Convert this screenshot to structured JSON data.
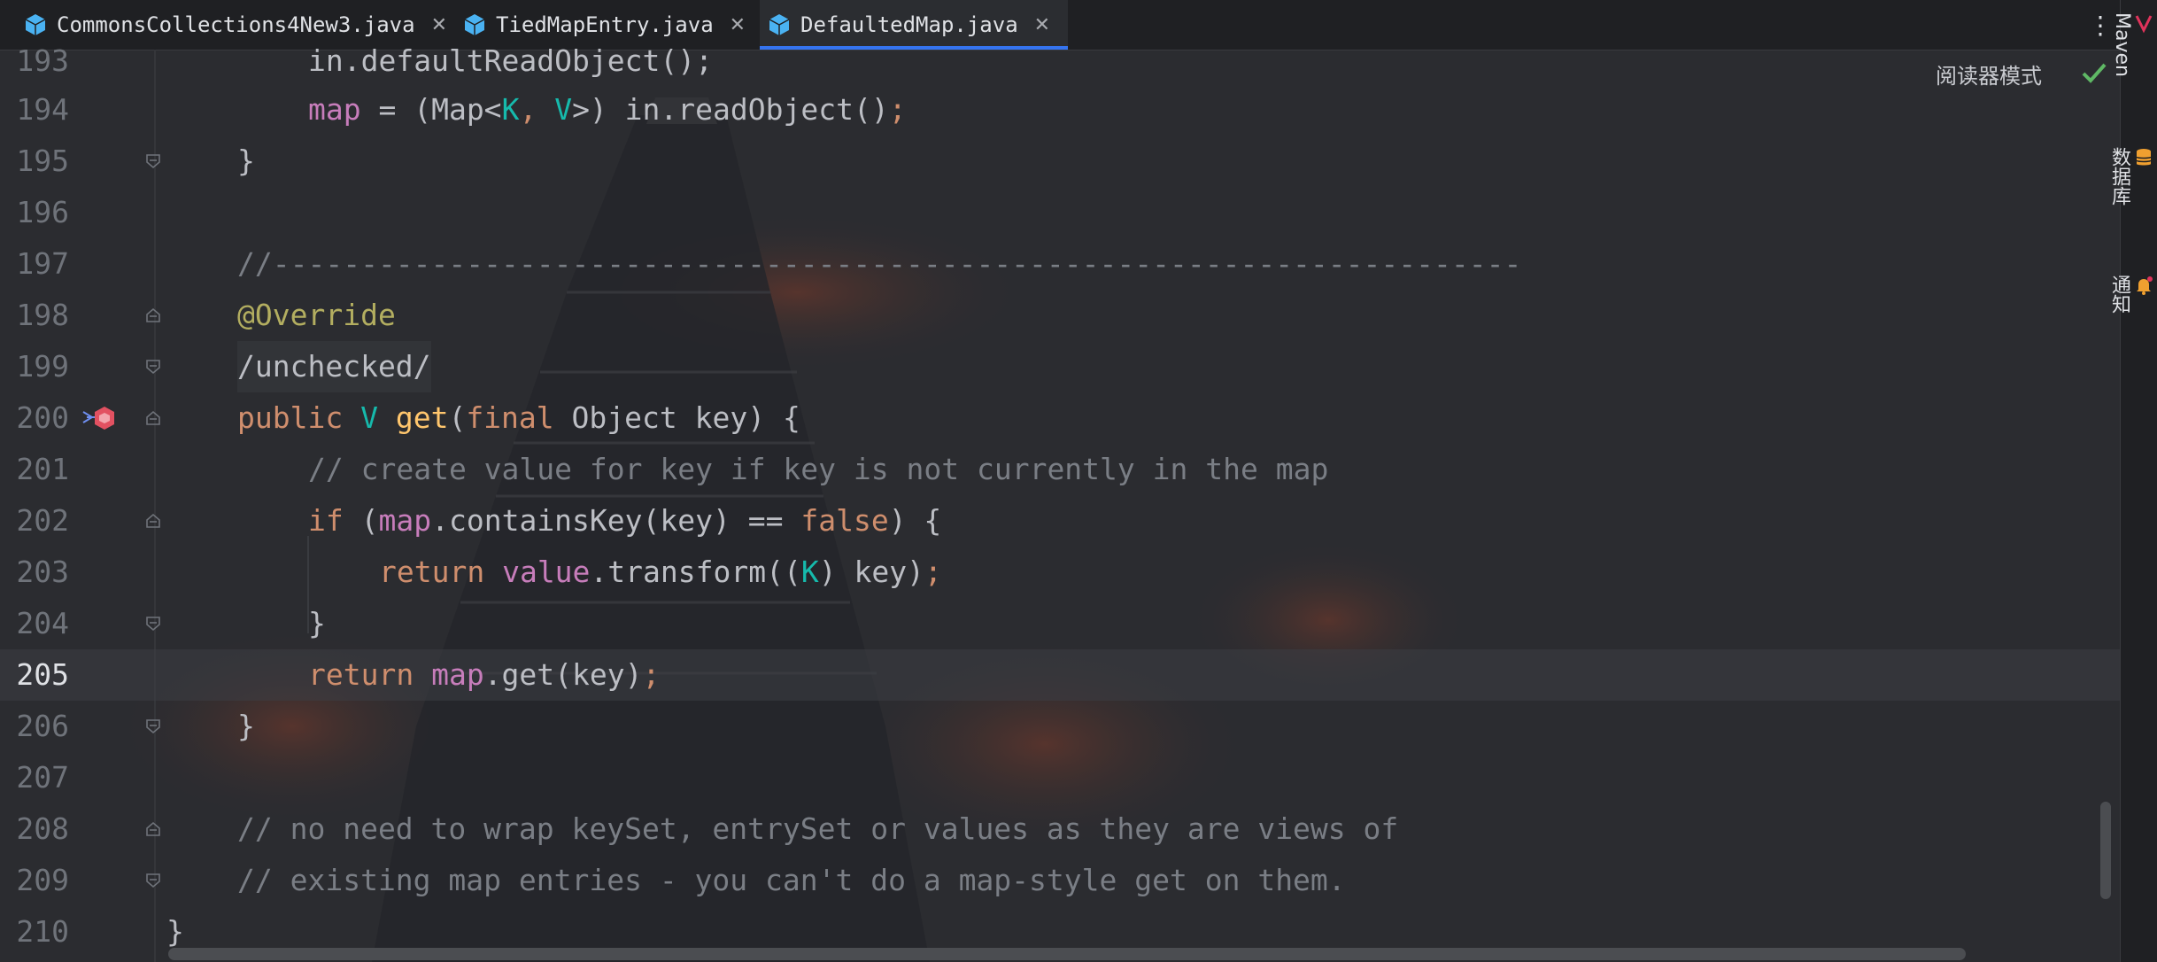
{
  "tabs": [
    {
      "label": "CommonsCollections4New3.java",
      "active": false
    },
    {
      "label": "TiedMapEntry.java",
      "active": false
    },
    {
      "label": "DefaultedMap.java",
      "active": true
    }
  ],
  "editor": {
    "reader_mode_label": "阅读器模式",
    "current_line": "205"
  },
  "lines": {
    "l193": {
      "no": "193",
      "code": "in.defaultReadObject();"
    },
    "l194": {
      "no": "194",
      "a": "map",
      "b": " = (Map<",
      "c": "K",
      "d": ", ",
      "e": "V",
      "f": ">) in.readObject()",
      "g": ";"
    },
    "l195": {
      "no": "195",
      "code": "}"
    },
    "l196": {
      "no": "196"
    },
    "l197": {
      "no": "197",
      "code": "//-----------------------------------------------------------------------"
    },
    "l198": {
      "no": "198",
      "code": "@Override"
    },
    "l199": {
      "no": "199",
      "code": "/unchecked/"
    },
    "l200": {
      "no": "200",
      "a": "public ",
      "b": "V",
      "c": " ",
      "d": "get",
      "e": "(",
      "f": "final ",
      "g": "Object key) {"
    },
    "l201": {
      "no": "201",
      "code": "// create value for key if key is not currently in the map"
    },
    "l202": {
      "no": "202",
      "a": "if",
      "b": " (",
      "c": "map",
      "d": ".containsKey(key) == ",
      "e": "false",
      "f": ") {"
    },
    "l203": {
      "no": "203",
      "a": "return ",
      "b": "value",
      "c": ".transform((",
      "d": "K",
      "e": ") key)",
      "f": ";"
    },
    "l204": {
      "no": "204",
      "code": "}"
    },
    "l205": {
      "no": "205",
      "a": "return ",
      "b": "map",
      "c": ".get(key)",
      "d": ";"
    },
    "l206": {
      "no": "206",
      "code": "}"
    },
    "l207": {
      "no": "207"
    },
    "l208": {
      "no": "208",
      "code": "// no need to wrap keySet, entrySet or values as they are views of"
    },
    "l209": {
      "no": "209",
      "code": "// existing map entries - you can't do a map-style get on them."
    },
    "l210": {
      "no": "210",
      "code": "}"
    }
  },
  "right_tools": [
    {
      "label": "Maven",
      "icon": "maven-icon"
    },
    {
      "label": "数据库",
      "icon": "database-icon"
    },
    {
      "label": "通知",
      "icon": "bell-icon"
    }
  ],
  "colors": {
    "keyword": "#cf8e6d",
    "field": "#c77dbb",
    "generic": "#16baac",
    "method": "#ffc66d",
    "annotation": "#b3ae60",
    "comment": "#7a7e85",
    "accent": "#3574f0"
  }
}
